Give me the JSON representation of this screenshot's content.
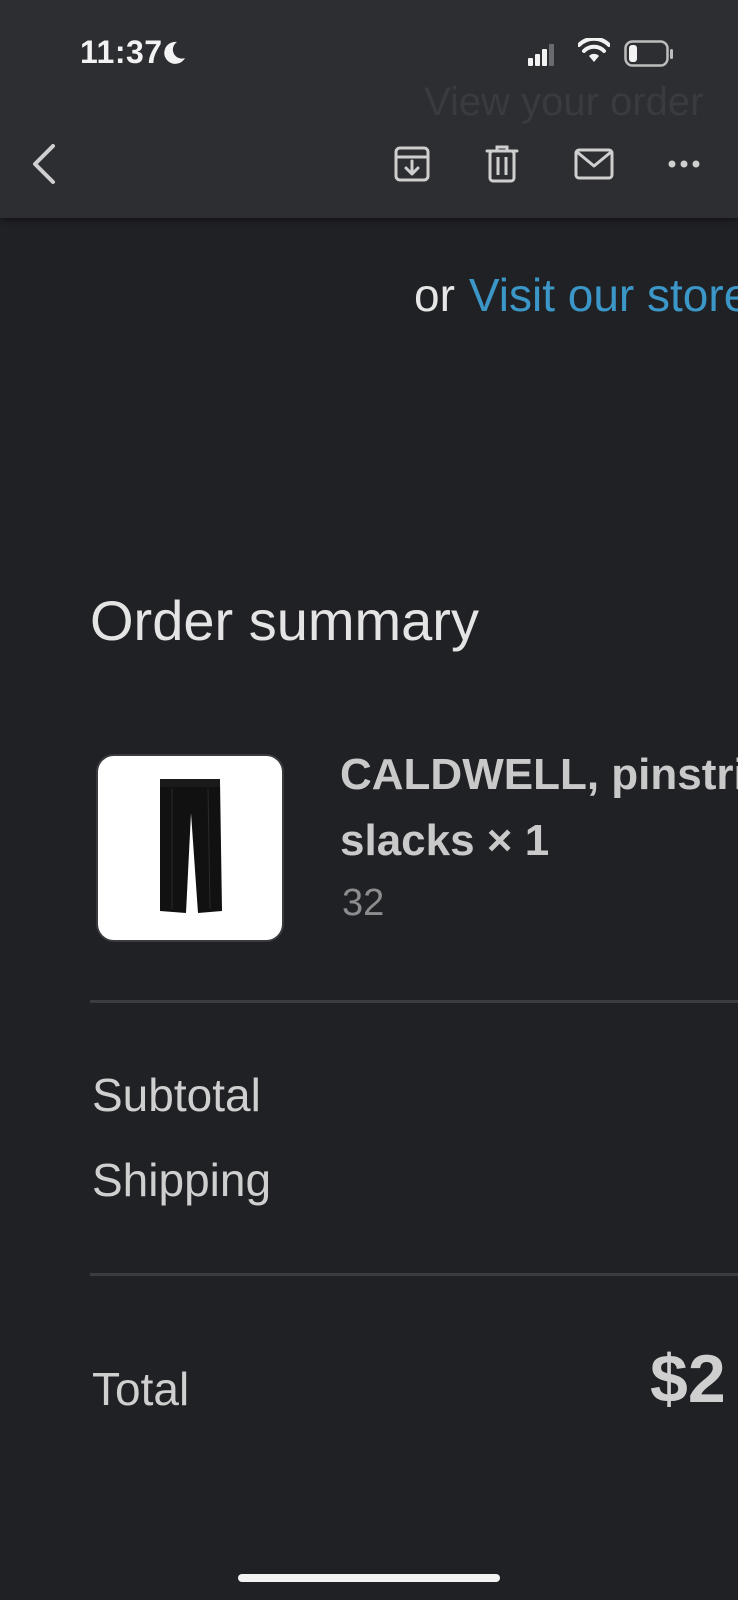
{
  "status_bar": {
    "time": "11:37",
    "icons": [
      "moon-icon",
      "cellular-signal-icon",
      "wifi-icon",
      "battery-icon"
    ]
  },
  "toolbar": {
    "ghost_text": "View your order",
    "buttons": [
      "back-icon",
      "archive-icon",
      "trash-icon",
      "mail-icon",
      "more-icon"
    ]
  },
  "email": {
    "store_prefix": "or",
    "store_link": "Visit our store",
    "order_summary_title": "Order summary",
    "product": {
      "name_line1": "CALDWELL, pinstripe",
      "name_line2": "slacks × 1",
      "variant": "32",
      "image": "black-pinstripe-slacks"
    },
    "subtotal_label": "Subtotal",
    "shipping_label": "Shipping",
    "total_label": "Total",
    "total_value": "$2"
  },
  "colors": {
    "background": "#202125",
    "toolbar": "#2d2e32",
    "link": "#3c97c9",
    "text": "#e4e4e4"
  }
}
